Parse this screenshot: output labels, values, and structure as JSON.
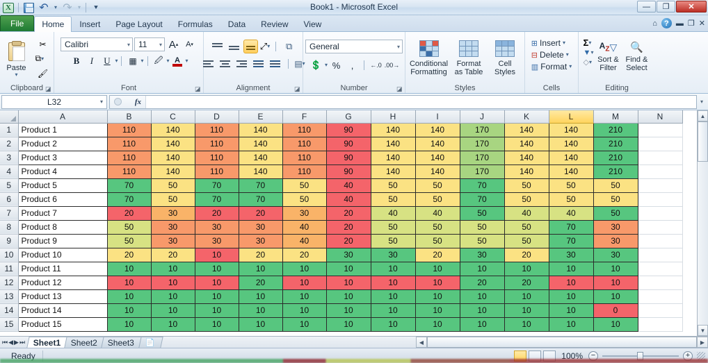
{
  "window": {
    "title": "Book1  -  Microsoft Excel",
    "minimize": "—",
    "restore": "❐",
    "close": "✕"
  },
  "quick_access": {
    "excel_logo": "X",
    "save": "save-icon",
    "undo": "↶",
    "redo": "↷",
    "customize": "▾"
  },
  "ribbon": {
    "tabs": [
      {
        "label": "File"
      },
      {
        "label": "Home"
      },
      {
        "label": "Insert"
      },
      {
        "label": "Page Layout"
      },
      {
        "label": "Formulas"
      },
      {
        "label": "Data"
      },
      {
        "label": "Review"
      },
      {
        "label": "View"
      }
    ],
    "active_tab": "Home",
    "help": "?",
    "minimize_ribbon": "▬",
    "restore_window": "❐",
    "close_window": "✕",
    "groups": {
      "clipboard": {
        "label": "Clipboard",
        "paste": "Paste",
        "cut": "✂",
        "copy": "⧉",
        "format_painter": "🖌"
      },
      "font": {
        "label": "Font",
        "font_name": "Calibri",
        "font_size": "11",
        "grow_font": "A",
        "shrink_font": "A",
        "bold": "B",
        "italic": "I",
        "underline": "U",
        "borders": "▦",
        "fill_color": "A",
        "font_color": "A"
      },
      "alignment": {
        "label": "Alignment",
        "top_align": "top-align",
        "middle_align": "middle-align",
        "bottom_align": "bottom-align",
        "orientation": "orientation",
        "wrap_text": "wrap-text",
        "align_left": "align-left",
        "align_center": "align-center",
        "align_right": "align-right",
        "decrease_indent": "decrease-indent",
        "increase_indent": "increase-indent",
        "merge_center": "merge-center"
      },
      "number": {
        "label": "Number",
        "format": "General",
        "accounting": "accounting-format",
        "percent": "%",
        "comma": ",",
        "increase_decimal": ".00",
        "decrease_decimal": ".00"
      },
      "styles": {
        "label": "Styles",
        "conditional_formatting": "Conditional\nFormatting",
        "conditional_formatting_l1": "Conditional",
        "conditional_formatting_l2": "Formatting",
        "format_as_table_l1": "Format",
        "format_as_table_l2": "as Table",
        "cell_styles_l1": "Cell",
        "cell_styles_l2": "Styles"
      },
      "cells": {
        "label": "Cells",
        "insert": "Insert",
        "delete": "Delete",
        "format": "Format"
      },
      "editing": {
        "label": "Editing",
        "autosum": "Σ",
        "fill": "▼",
        "clear": "◇",
        "sort_filter_l1": "Sort &",
        "sort_filter_l2": "Filter",
        "find_select_l1": "Find &",
        "find_select_l2": "Select"
      }
    }
  },
  "formula_bar": {
    "name_box": "L32",
    "name_box_caret": "▾",
    "cancel": "✕",
    "enter": "✓",
    "insert_function": "fx",
    "formula_value": "",
    "expand_caret": "▾"
  },
  "grid": {
    "selected_column": "L",
    "columns": [
      "A",
      "B",
      "C",
      "D",
      "E",
      "F",
      "G",
      "H",
      "I",
      "J",
      "K",
      "L",
      "M",
      "N"
    ],
    "rows": [
      {
        "n": "1",
        "label": "Product 1",
        "values": [
          110,
          140,
          110,
          140,
          110,
          90,
          140,
          140,
          170,
          140,
          140,
          210
        ]
      },
      {
        "n": "2",
        "label": "Product 2",
        "values": [
          110,
          140,
          110,
          140,
          110,
          90,
          140,
          140,
          170,
          140,
          140,
          210
        ]
      },
      {
        "n": "3",
        "label": "Product 3",
        "values": [
          110,
          140,
          110,
          140,
          110,
          90,
          140,
          140,
          170,
          140,
          140,
          210
        ]
      },
      {
        "n": "4",
        "label": "Product 4",
        "values": [
          110,
          140,
          110,
          140,
          110,
          90,
          140,
          140,
          170,
          140,
          140,
          210
        ]
      },
      {
        "n": "5",
        "label": "Product 5",
        "values": [
          70,
          50,
          70,
          70,
          50,
          40,
          50,
          50,
          70,
          50,
          50,
          50
        ]
      },
      {
        "n": "6",
        "label": "Product 6",
        "values": [
          70,
          50,
          70,
          70,
          50,
          40,
          50,
          50,
          70,
          50,
          50,
          50
        ]
      },
      {
        "n": "7",
        "label": "Product 7",
        "values": [
          20,
          30,
          20,
          20,
          30,
          20,
          40,
          40,
          50,
          40,
          40,
          50
        ]
      },
      {
        "n": "8",
        "label": "Product 8",
        "values": [
          50,
          30,
          30,
          30,
          40,
          20,
          50,
          50,
          50,
          50,
          70,
          30
        ]
      },
      {
        "n": "9",
        "label": "Product 9",
        "values": [
          50,
          30,
          30,
          30,
          40,
          20,
          50,
          50,
          50,
          50,
          70,
          30
        ]
      },
      {
        "n": "10",
        "label": "Product 10",
        "values": [
          20,
          20,
          10,
          20,
          20,
          30,
          30,
          20,
          30,
          20,
          30,
          30
        ]
      },
      {
        "n": "11",
        "label": "Product 11",
        "values": [
          10,
          10,
          10,
          10,
          10,
          10,
          10,
          10,
          10,
          10,
          10,
          10
        ]
      },
      {
        "n": "12",
        "label": "Product 12",
        "values": [
          10,
          10,
          10,
          20,
          10,
          10,
          10,
          10,
          20,
          20,
          10,
          10
        ]
      },
      {
        "n": "13",
        "label": "Product 13",
        "values": [
          10,
          10,
          10,
          10,
          10,
          10,
          10,
          10,
          10,
          10,
          10,
          10
        ]
      },
      {
        "n": "14",
        "label": "Product 14",
        "values": [
          10,
          10,
          10,
          10,
          10,
          10,
          10,
          10,
          10,
          10,
          10,
          0
        ]
      },
      {
        "n": "15",
        "label": "Product 15",
        "values": [
          10,
          10,
          10,
          10,
          10,
          10,
          10,
          10,
          10,
          10,
          10,
          10
        ]
      }
    ],
    "cell_colors": [
      [
        "#f8996a",
        "#fbe283",
        "#f8996a",
        "#fbe283",
        "#f8996a",
        "#f4646a",
        "#fbe283",
        "#fbe283",
        "#a8d581",
        "#fbe283",
        "#fbe283",
        "#57c67f"
      ],
      [
        "#f8996a",
        "#fbe283",
        "#f8996a",
        "#fbe283",
        "#f8996a",
        "#f4646a",
        "#fbe283",
        "#fbe283",
        "#a8d581",
        "#fbe283",
        "#fbe283",
        "#57c67f"
      ],
      [
        "#f8996a",
        "#fbe283",
        "#f8996a",
        "#fbe283",
        "#f8996a",
        "#f4646a",
        "#fbe283",
        "#fbe283",
        "#a8d581",
        "#fbe283",
        "#fbe283",
        "#57c67f"
      ],
      [
        "#f8996a",
        "#fbe283",
        "#f8996a",
        "#fbe283",
        "#f8996a",
        "#f4646a",
        "#fbe283",
        "#fbe283",
        "#a8d581",
        "#fbe283",
        "#fbe283",
        "#57c67f"
      ],
      [
        "#57c67f",
        "#fbe283",
        "#57c67f",
        "#57c67f",
        "#fbe283",
        "#f4646a",
        "#fbe283",
        "#fbe283",
        "#57c67f",
        "#fbe283",
        "#fbe283",
        "#fbe283"
      ],
      [
        "#57c67f",
        "#fbe283",
        "#57c67f",
        "#57c67f",
        "#fbe283",
        "#f4646a",
        "#fbe283",
        "#fbe283",
        "#57c67f",
        "#fbe283",
        "#fbe283",
        "#fbe283"
      ],
      [
        "#f4646a",
        "#f9b368",
        "#f4646a",
        "#f4646a",
        "#f9b368",
        "#f4646a",
        "#d7e283",
        "#d7e283",
        "#57c67f",
        "#d7e283",
        "#d7e283",
        "#57c67f"
      ],
      [
        "#d7e283",
        "#f8996a",
        "#f8996a",
        "#f8996a",
        "#f9b368",
        "#f4646a",
        "#d7e283",
        "#d7e283",
        "#d7e283",
        "#d7e283",
        "#57c67f",
        "#f8996a"
      ],
      [
        "#d7e283",
        "#f8996a",
        "#f8996a",
        "#f8996a",
        "#f9b368",
        "#f4646a",
        "#d7e283",
        "#d7e283",
        "#d7e283",
        "#d7e283",
        "#57c67f",
        "#f8996a"
      ],
      [
        "#fbe283",
        "#fbe283",
        "#f4646a",
        "#fbe283",
        "#fbe283",
        "#57c67f",
        "#57c67f",
        "#fbe283",
        "#57c67f",
        "#fbe283",
        "#57c67f",
        "#57c67f"
      ],
      [
        "#57c67f",
        "#57c67f",
        "#57c67f",
        "#57c67f",
        "#57c67f",
        "#57c67f",
        "#57c67f",
        "#57c67f",
        "#57c67f",
        "#57c67f",
        "#57c67f",
        "#57c67f"
      ],
      [
        "#f4646a",
        "#f4646a",
        "#f4646a",
        "#57c67f",
        "#f4646a",
        "#f4646a",
        "#f4646a",
        "#f4646a",
        "#57c67f",
        "#57c67f",
        "#f4646a",
        "#f4646a"
      ],
      [
        "#57c67f",
        "#57c67f",
        "#57c67f",
        "#57c67f",
        "#57c67f",
        "#57c67f",
        "#57c67f",
        "#57c67f",
        "#57c67f",
        "#57c67f",
        "#57c67f",
        "#57c67f"
      ],
      [
        "#57c67f",
        "#57c67f",
        "#57c67f",
        "#57c67f",
        "#57c67f",
        "#57c67f",
        "#57c67f",
        "#57c67f",
        "#57c67f",
        "#57c67f",
        "#57c67f",
        "#f4646a"
      ],
      [
        "#57c67f",
        "#57c67f",
        "#57c67f",
        "#57c67f",
        "#57c67f",
        "#57c67f",
        "#57c67f",
        "#57c67f",
        "#57c67f",
        "#57c67f",
        "#57c67f",
        "#57c67f"
      ]
    ]
  },
  "sheet_tabs": {
    "first": "⏮",
    "prev": "◀",
    "next": "▶",
    "last": "⏭",
    "tabs": [
      {
        "label": "Sheet1",
        "active": true
      },
      {
        "label": "Sheet2",
        "active": false
      },
      {
        "label": "Sheet3",
        "active": false
      }
    ],
    "insert_sheet": "insert-worksheet"
  },
  "status_bar": {
    "mode": "Ready",
    "view_normal": "normal-view",
    "view_page_layout": "page-layout-view",
    "view_page_break": "page-break-preview",
    "zoom": "100%",
    "zoom_out": "−",
    "zoom_in": "+"
  },
  "scrollbars": {
    "up": "▲",
    "down": "▼",
    "left": "◀",
    "right": "▶"
  }
}
